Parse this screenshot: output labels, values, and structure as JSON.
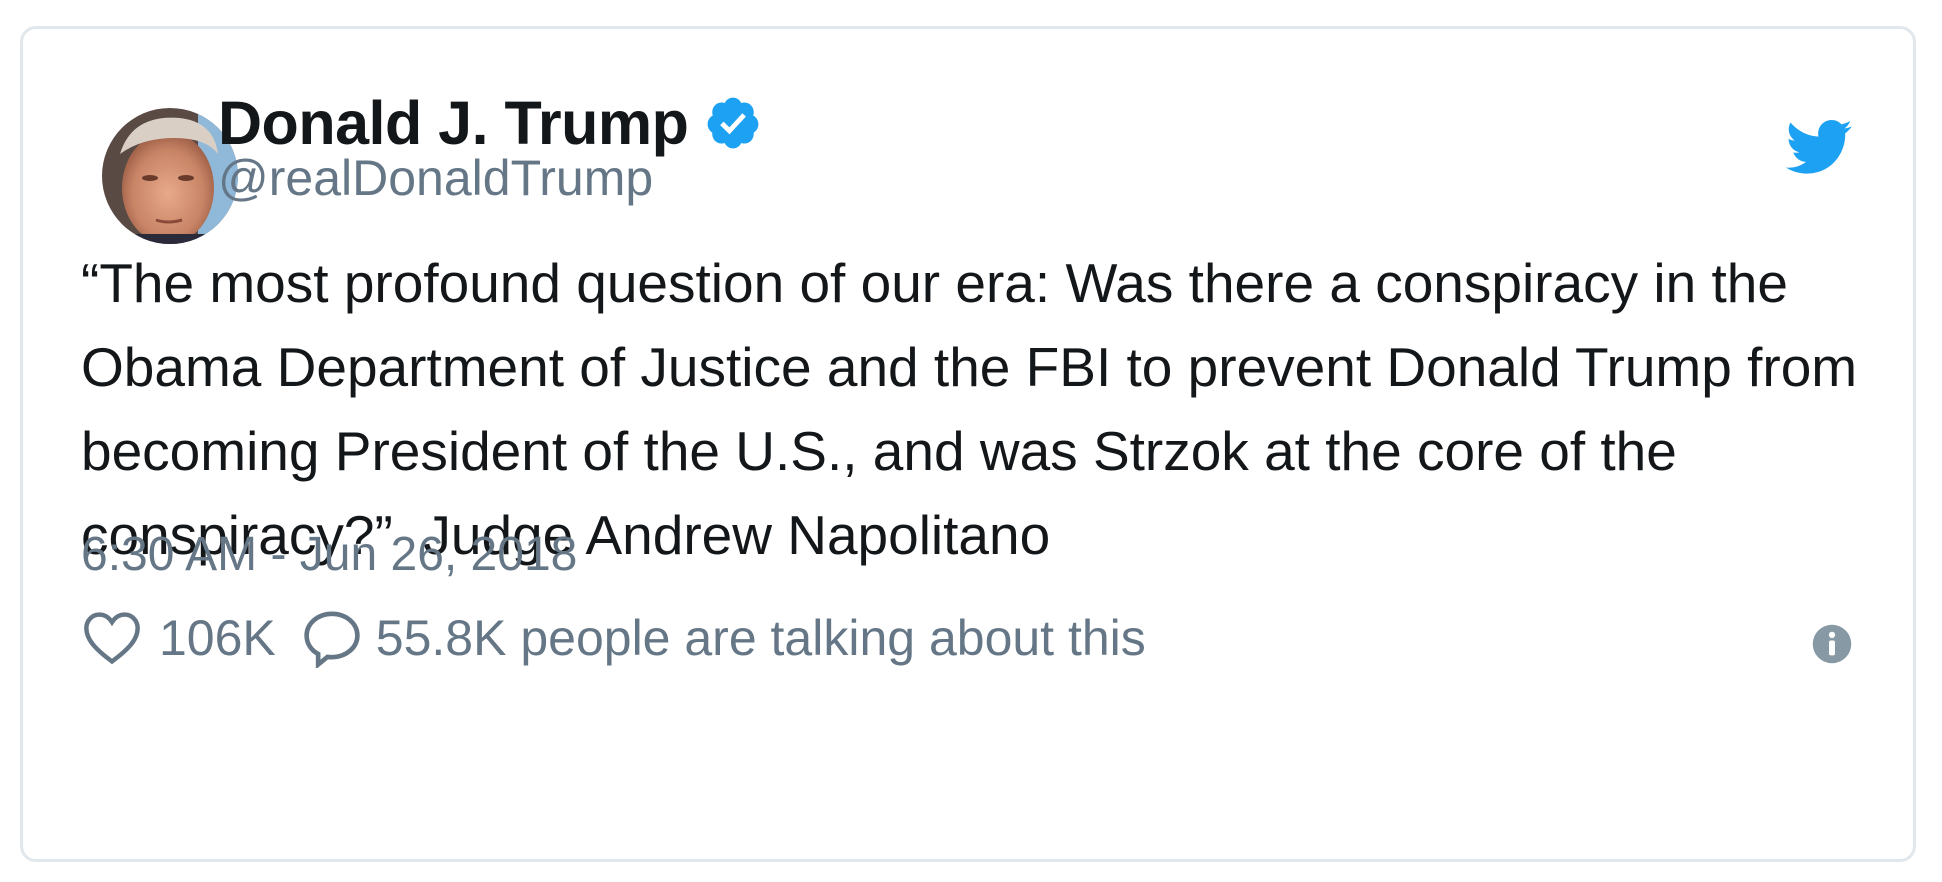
{
  "tweet": {
    "author": {
      "display_name": "Donald J. Trump",
      "handle": "@realDonaldTrump",
      "verified": true,
      "avatar_icon": "profile-photo"
    },
    "brand_icon": "twitter-bird-icon",
    "brand_color": "#1da1f2",
    "text": "“The most profound question of our era: Was there a conspiracy in the Obama Department of Justice and the FBI to prevent Donald Trump from becoming President of the U.S., and was Strzok at the core of the conspiracy?”  Judge Andrew Napolitano",
    "timestamp": "6:30 AM - Jun 26, 2018",
    "likes": "106K",
    "talking": "55.8K people are talking about this",
    "info_icon": "info-icon"
  }
}
